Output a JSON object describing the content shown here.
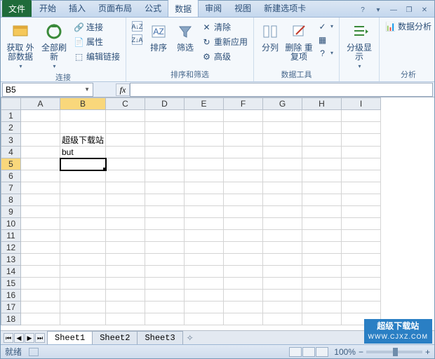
{
  "tabs": {
    "file": "文件",
    "items": [
      "开始",
      "插入",
      "页面布局",
      "公式",
      "数据",
      "审阅",
      "视图",
      "新建选项卡"
    ],
    "active": 4
  },
  "ribbon": {
    "groups": [
      {
        "label": "连接",
        "big": [
          {
            "name": "get-external-data",
            "text": "获取\n外部数据"
          },
          {
            "name": "refresh-all",
            "text": "全部刷新"
          }
        ],
        "small": [
          {
            "name": "connections",
            "text": "连接"
          },
          {
            "name": "properties",
            "text": "属性"
          },
          {
            "name": "edit-links",
            "text": "编辑链接"
          }
        ]
      },
      {
        "label": "排序和筛选",
        "big": [
          {
            "name": "sort-az",
            "text": ""
          },
          {
            "name": "sort-za",
            "text": ""
          },
          {
            "name": "sort",
            "text": "排序"
          },
          {
            "name": "filter",
            "text": "筛选"
          }
        ],
        "small": [
          {
            "name": "clear",
            "text": "清除"
          },
          {
            "name": "reapply",
            "text": "重新应用"
          },
          {
            "name": "advanced",
            "text": "高级"
          }
        ]
      },
      {
        "label": "数据工具",
        "big": [
          {
            "name": "text-to-columns",
            "text": "分列"
          },
          {
            "name": "remove-duplicates",
            "text": "删除\n重复项"
          }
        ],
        "small": []
      },
      {
        "label": "",
        "big": [
          {
            "name": "outline",
            "text": "分级显示"
          }
        ],
        "small": []
      },
      {
        "label": "分析",
        "big": [
          {
            "name": "data-analysis",
            "text": "数据分析"
          }
        ],
        "small": []
      }
    ]
  },
  "namebox": "B5",
  "formula": "",
  "columns": [
    "A",
    "B",
    "C",
    "D",
    "E",
    "F",
    "G",
    "H",
    "I"
  ],
  "rows": 18,
  "cells": {
    "B3": "超级下载站",
    "B4": "but"
  },
  "activeCell": "B5",
  "sheetTabs": [
    "Sheet1",
    "Sheet2",
    "Sheet3"
  ],
  "activeSheet": 0,
  "status": {
    "ready": "就绪",
    "zoom": "100%"
  },
  "watermark": {
    "title": "超级下载站",
    "url": "WWW.CJXZ.COM"
  }
}
